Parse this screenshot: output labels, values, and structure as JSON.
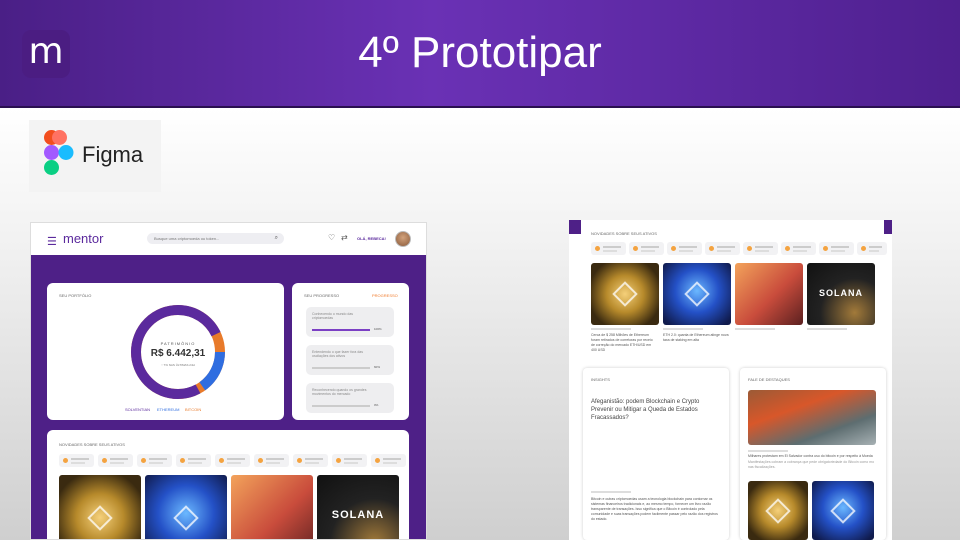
{
  "slide": {
    "logo_letter": "m",
    "title": "4º Prototipar",
    "figma_label": "Figma"
  },
  "mock_left": {
    "brand": "mentor",
    "search_placeholder": "Busque uma criptomoeda ou token...",
    "greeting": "OLÁ, REBECA!",
    "portfolio_title": "SEU PORTFÓLIO",
    "patrimonio_label": "PATRIMÔNIO",
    "patrimonio_value": "R$ 6.442,31",
    "patrimonio_change": "↑ 7% NAS ÚLTIMAS 24H",
    "legend": [
      "SOLVENTIAN",
      "ETHEREUM",
      "BITCOIN"
    ],
    "progress_title": "SEU PROGRESSO",
    "progress_button": "PROGRESSO",
    "progress_items": [
      {
        "text": "Conhecendo o mundo das criptomoedas",
        "pct": "100%",
        "value": 1.0,
        "color": "#7b3fc4"
      },
      {
        "text": "Entendendo o que fazer fora das oscilações dos ativos",
        "pct": "60%",
        "value": 0.6,
        "color": "#f07a2a"
      },
      {
        "text": "Reconhecendo quando os grandes movimentos do mercado",
        "pct": "0%",
        "value": 0.0,
        "color": "#ccc"
      }
    ],
    "news_title": "NOVIDADES SOBRE SEUS ATIVOS",
    "solana_text": "SOLANA"
  },
  "mock_right": {
    "news_title": "NOVIDADES SOBRE SEUS ATIVOS",
    "captions": [
      "Cerca de $ 258 Milhões de Ethereum foram retirados de corretoras por receio de correção do mercado ETH/USD em 400 USD",
      "ETH 2.0: quanta de Ethereum atinge nova taxa de staking em alta",
      "",
      ""
    ],
    "solana_text": "SOLANA",
    "insights_label": "INSIGHTS",
    "article_title": "Afeganistão: podem Blockchain e Crypto Prevenir ou Mitigar a Queda de Estados Fracassados?",
    "article_body": "Bitcoin e outras criptomoedas usam a tecnologia blockchain para contornar os sistemas financeiros tradicionais e, ao mesmo tempo, fornecer um livro razão transparente de transações. Isso significa que o Bitcoin é controlado pela comunidade e suas transações podem facilmente passar pelo razão dos registros do estado.",
    "featured_label": "FALE DE DESTAQUES",
    "featured_caption": "Milhares protestam em El Salvador contra uso do bitcoin e por respeito à Moeda",
    "featured_sub": "Manifestações cobram a cobrança que pede obrigatoriedade do Bitcoin como mo nas fiscalizações."
  }
}
